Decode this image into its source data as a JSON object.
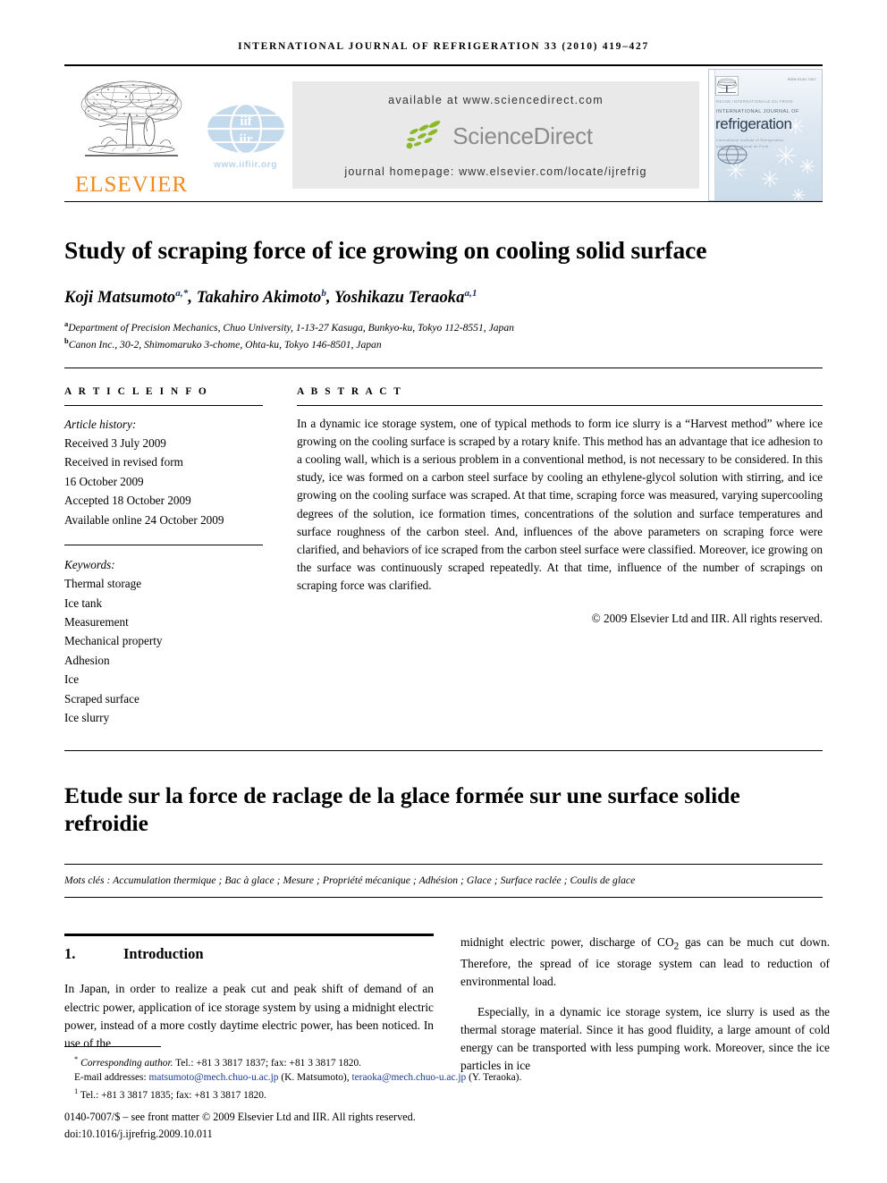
{
  "running_head": "INTERNATIONAL JOURNAL OF REFRIGERATION 33 (2010) 419–427",
  "masthead": {
    "elsevier_wordmark": "ELSEVIER",
    "elsevier_orange": "#F08A1E",
    "iif_url": "www.iifiir.org",
    "sciencedirect": {
      "available_at": "available at www.sciencedirect.com",
      "logo_text": "ScienceDirect",
      "journal_homepage": "journal homepage: www.elsevier.com/locate/ijrefrig",
      "banner_bg": "#e9e9e9",
      "logo_gray": "#8b8b8b",
      "leaf_green": "#8cb82b"
    },
    "cover": {
      "issn_line": "ISSN 0140-7007",
      "revue_line": "REVUE INTERNATIONALE DU FROID",
      "ij_line": "INTERNATIONAL JOURNAL OF",
      "title": "refrigeration",
      "sub_line_1": "International Institute of Refrigeration",
      "sub_line_2": "Institut International du Froid"
    }
  },
  "article": {
    "title": "Study of scraping force of ice growing on cooling solid surface",
    "authors": [
      {
        "name": "Koji Matsumoto",
        "sup": "a,*"
      },
      {
        "name": "Takahiro Akimoto",
        "sup": "b"
      },
      {
        "name": "Yoshikazu Teraoka",
        "sup": "a,1"
      }
    ],
    "affiliations": [
      {
        "mark": "a",
        "text": "Department of Precision Mechanics, Chuo University, 1-13-27 Kasuga, Bunkyo-ku, Tokyo 112-8551, Japan"
      },
      {
        "mark": "b",
        "text": "Canon Inc., 30-2, Shimomaruko 3-chome, Ohta-ku, Tokyo 146-8501, Japan"
      }
    ]
  },
  "article_info": {
    "heading": "A R T I C L E   I N F O",
    "history_label": "Article history:",
    "history": [
      "Received 3 July 2009",
      "Received in revised form",
      "16 October 2009",
      "Accepted 18 October 2009",
      "Available online 24 October 2009"
    ],
    "keywords_label": "Keywords:",
    "keywords": [
      "Thermal storage",
      "Ice tank",
      "Measurement",
      "Mechanical property",
      "Adhesion",
      "Ice",
      "Scraped surface",
      "Ice slurry"
    ]
  },
  "abstract": {
    "heading": "A B S T R A C T",
    "text": "In a dynamic ice storage system, one of typical methods to form ice slurry is a “Harvest method” where ice growing on the cooling surface is scraped by a rotary knife. This method has an advantage that ice adhesion to a cooling wall, which is a serious problem in a conventional method, is not necessary to be considered. In this study, ice was formed on a carbon steel surface by cooling an ethylene-glycol solution with stirring, and ice growing on the cooling surface was scraped. At that time, scraping force was measured, varying supercooling degrees of the solution, ice formation times, concentrations of the solution and surface temperatures and surface roughness of the carbon steel. And, influences of the above parameters on scraping force were clarified, and behaviors of ice scraped from the carbon steel surface were classified. Moreover, ice growing on the surface was continuously scraped repeatedly. At that time, influence of the number of scrapings on scraping force was clarified.",
    "copyright": "© 2009 Elsevier Ltd and IIR. All rights reserved."
  },
  "french": {
    "title": "Etude sur la force de raclage de la glace formée sur une surface solide refroidie",
    "keywords": "Mots clés : Accumulation thermique ; Bac à glace ; Mesure ; Propriété mécanique ; Adhésion ; Glace ; Surface raclée ; Coulis de glace"
  },
  "body": {
    "section_number": "1.",
    "section_title": "Introduction",
    "left_paragraph": "In Japan, in order to realize a peak cut and peak shift of demand of an electric power, application of ice storage system by using a midnight electric power, instead of a more costly daytime electric power, has been noticed. In use of the",
    "right_paragraph_continued_prefix": "midnight electric power, discharge of CO",
    "right_paragraph_subscript": "2",
    "right_paragraph_continued_suffix": " gas can be much cut down. Therefore, the spread of ice storage system can lead to reduction of environmental load.",
    "right_paragraph_2": "Especially, in a dynamic ice storage system, ice slurry is used as the thermal storage material. Since it has good fluidity, a large amount of cold energy can be transported with less pumping work. Moreover, since the ice particles in ice"
  },
  "footnotes": {
    "corresponding_label": "Corresponding author.",
    "corresponding_tel": " Tel.: +81 3 3817 1837; fax: +81 3 3817 1820.",
    "email_label": "E-mail addresses:",
    "email_1": "matsumoto@mech.chuo-u.ac.jp",
    "email_1_owner": "(K. Matsumoto),",
    "email_2": "teraoka@mech.chuo-u.ac.jp",
    "email_2_owner": "(Y. Teraoka).",
    "note_1_mark": "1",
    "note_1_text": " Tel.: +81 3 3817 1835; fax: +81 3 3817 1820.",
    "issn_line": "0140-7007/$ – see front matter © 2009 Elsevier Ltd and IIR. All rights reserved.",
    "doi_line": "doi:10.1016/j.ijrefrig.2009.10.011",
    "link_color": "#1a3a8f"
  }
}
